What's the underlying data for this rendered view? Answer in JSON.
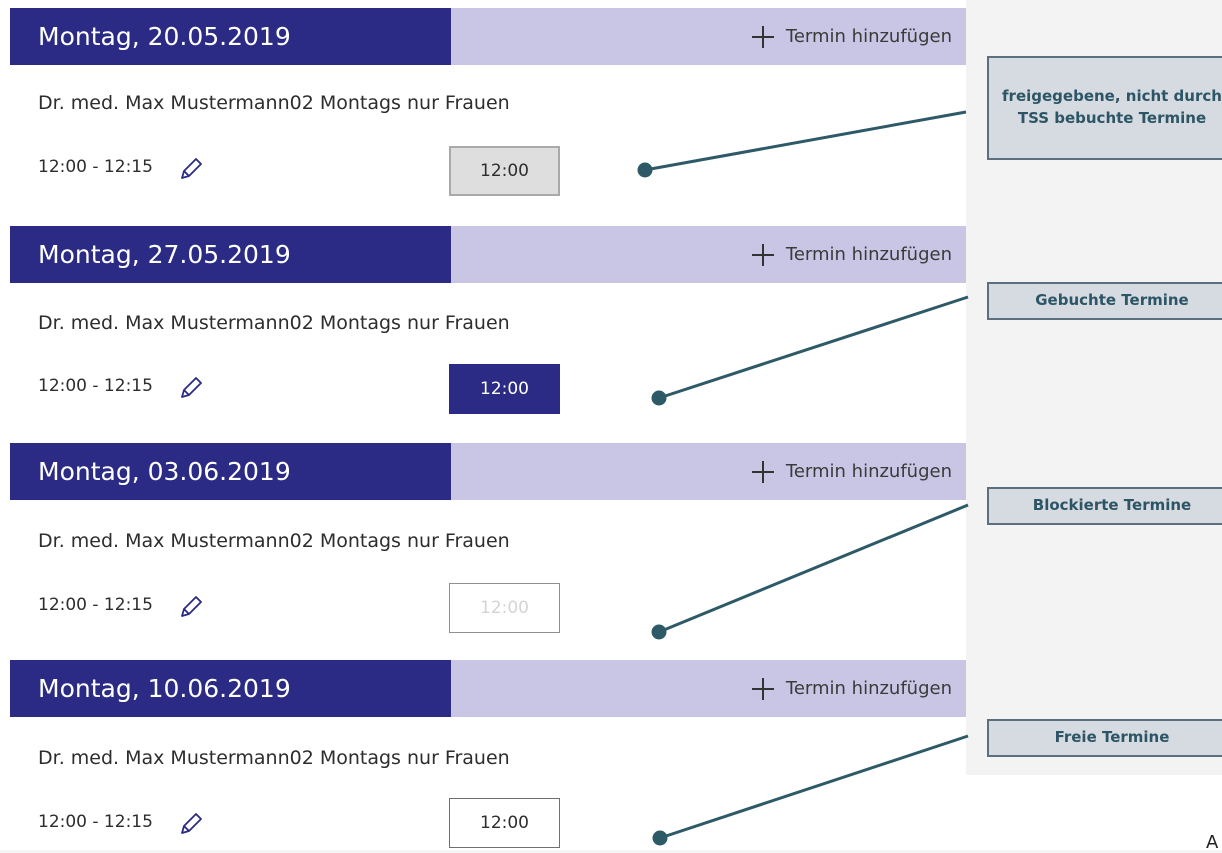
{
  "entries": [
    {
      "date": "Montag, 20.05.2019",
      "add_label": "Termin hinzufügen",
      "provider": "Dr. med. Max Mustermann02 Montags nur Frauen",
      "time_range": "12:00 - 12:15",
      "slot": "12:00",
      "slot_status": "released"
    },
    {
      "date": "Montag, 27.05.2019",
      "add_label": "Termin hinzufügen",
      "provider": "Dr. med. Max Mustermann02 Montags nur Frauen",
      "time_range": "12:00 - 12:15",
      "slot": "12:00",
      "slot_status": "booked"
    },
    {
      "date": "Montag, 03.06.2019",
      "add_label": "Termin hinzufügen",
      "provider": "Dr. med. Max Mustermann02 Montags nur Frauen",
      "time_range": "12:00 - 12:15",
      "slot": "12:00",
      "slot_status": "blocked"
    },
    {
      "date": "Montag, 10.06.2019",
      "add_label": "Termin hinzufügen",
      "provider": "Dr. med. Max Mustermann02 Montags nur Frauen",
      "time_range": "12:00 - 12:15",
      "slot": "12:00",
      "slot_status": "free"
    }
  ],
  "callouts": {
    "released": "freigegebene, nicht durch TSS bebuchte Termine",
    "booked": "Gebuchte Termine",
    "blocked": "Blockierte Termine",
    "free": "Freie Termine"
  },
  "bottom_glyph": "A",
  "colors": {
    "header_dark": "#2b2a84",
    "header_light": "#c8c6e4",
    "callout_bg": "#d5dbe1",
    "callout_border": "#5b6f7e",
    "callout_text": "#2d5565"
  },
  "icons": {
    "add": "plus-icon",
    "edit": "pencil-icon"
  }
}
